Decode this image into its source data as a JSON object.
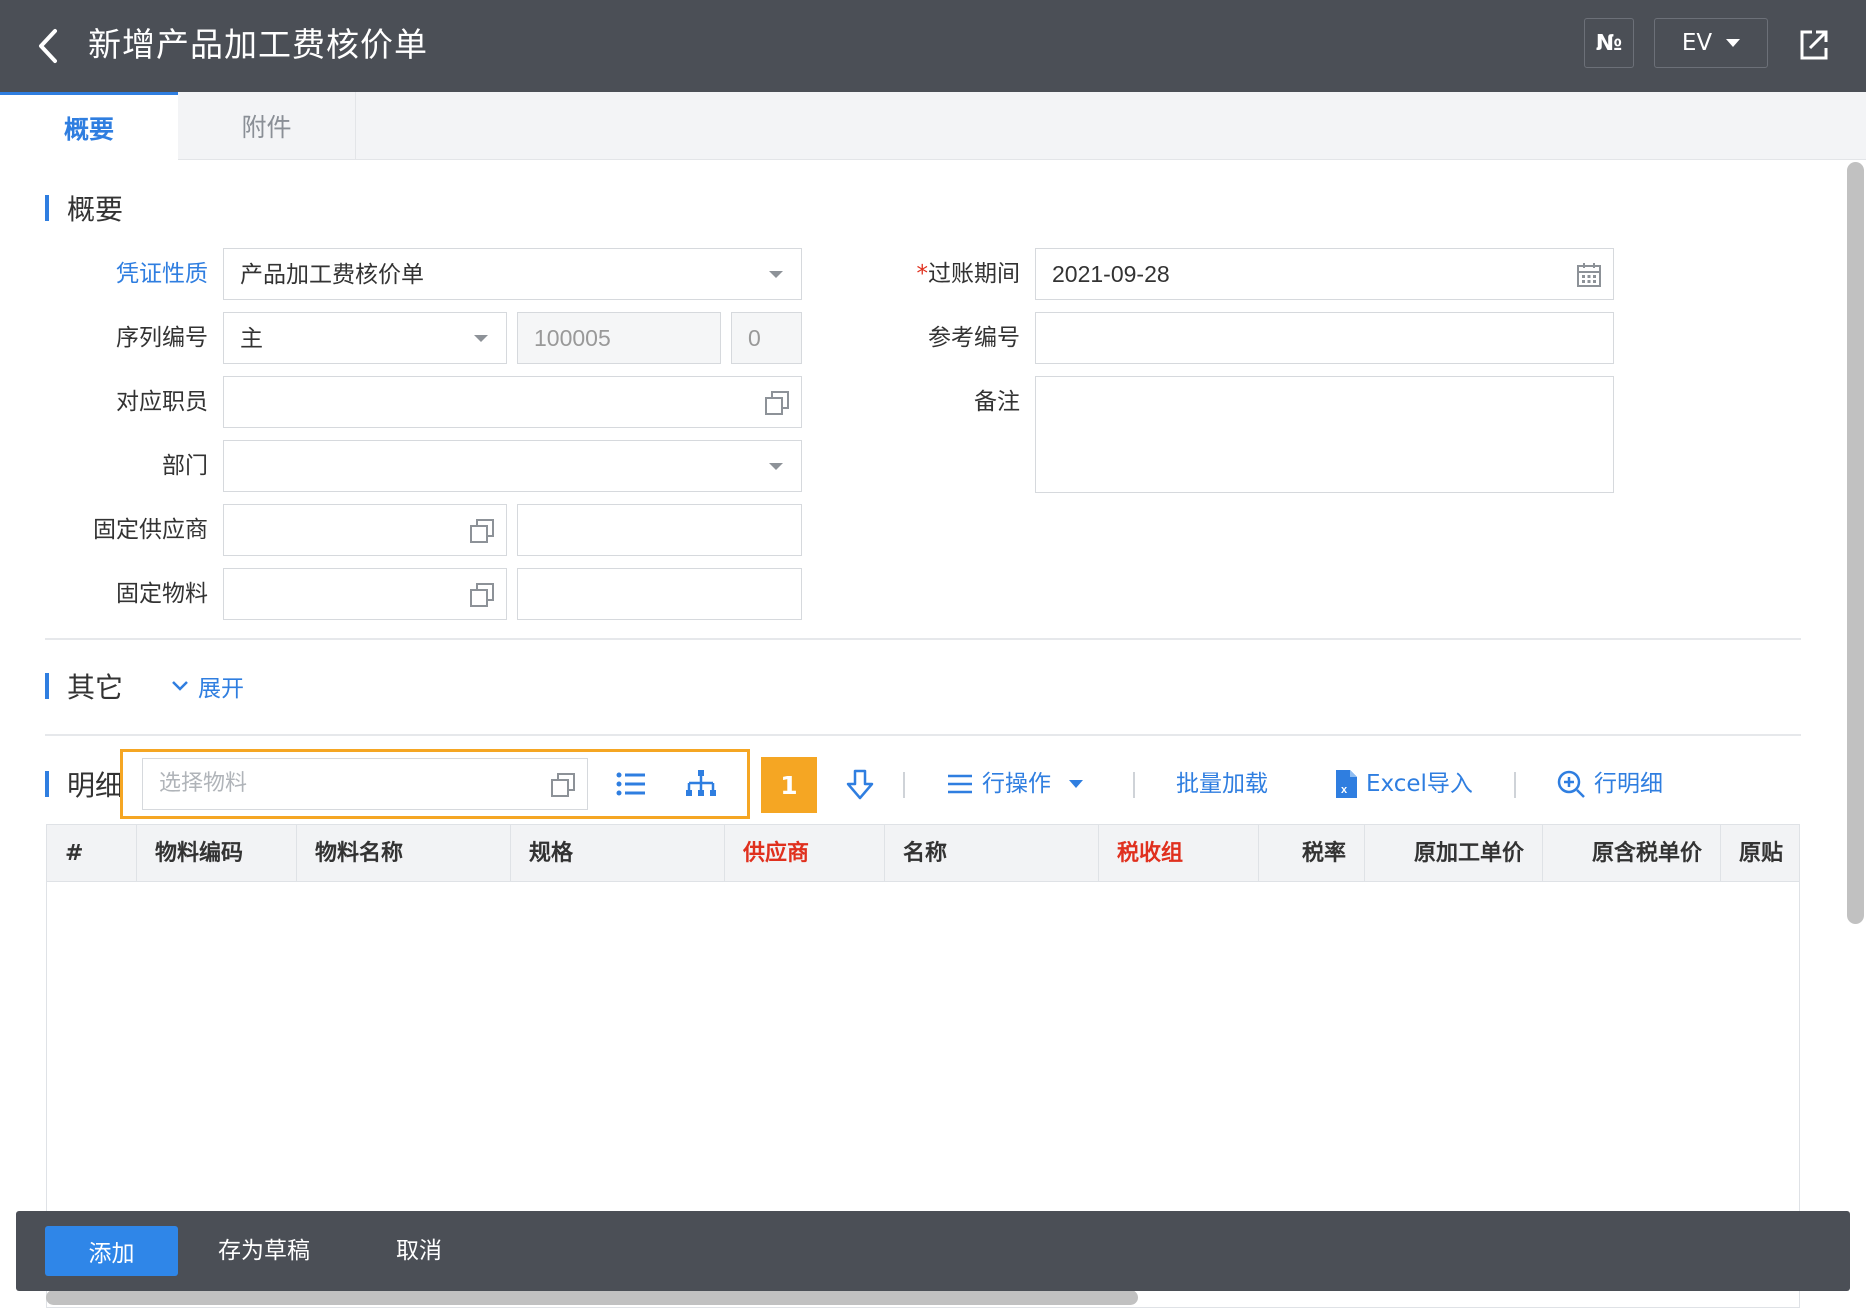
{
  "header": {
    "title": "新增产品加工费核价单",
    "numero_label": "№",
    "lang_label": "EV"
  },
  "tabs": [
    {
      "label": "概要",
      "active": true
    },
    {
      "label": "附件",
      "active": false
    }
  ],
  "summary": {
    "section_title": "概要",
    "fields": {
      "voucher_type": {
        "label": "凭证性质",
        "value": "产品加工费核价单"
      },
      "serial_no": {
        "label": "序列编号",
        "value": "主",
        "number": "100005",
        "suffix": "0"
      },
      "employee": {
        "label": "对应职员",
        "value": ""
      },
      "department": {
        "label": "部门",
        "value": ""
      },
      "fixed_supplier": {
        "label": "固定供应商",
        "value": "",
        "name": ""
      },
      "fixed_material": {
        "label": "固定物料",
        "value": "",
        "name": ""
      },
      "posting_period": {
        "required_mark": "*",
        "label": "过账期间",
        "value": "2021-09-28"
      },
      "reference_no": {
        "label": "参考编号",
        "value": ""
      },
      "remark": {
        "label": "备注",
        "value": ""
      }
    }
  },
  "other": {
    "section_title": "其它",
    "expand_label": "展开"
  },
  "detail": {
    "section_title": "明细",
    "material_placeholder": "选择物料",
    "step_number": "1",
    "toolbar": {
      "row_ops": "行操作",
      "bulk_load": "批量加载",
      "excel_import": "Excel导入",
      "row_detail": "行明细"
    },
    "columns": [
      "#",
      "物料编码",
      "物料名称",
      "规格",
      "供应商",
      "名称",
      "税收组",
      "税率",
      "原加工单价",
      "原含税单价",
      "原贴"
    ],
    "rows": []
  },
  "footer": {
    "add": "添加",
    "save_draft": "存为草稿",
    "cancel": "取消"
  },
  "colors": {
    "header_bg": "#4b4f56",
    "accent": "#2f7ee0",
    "required": "#e0301e",
    "highlight": "#f5a623"
  }
}
